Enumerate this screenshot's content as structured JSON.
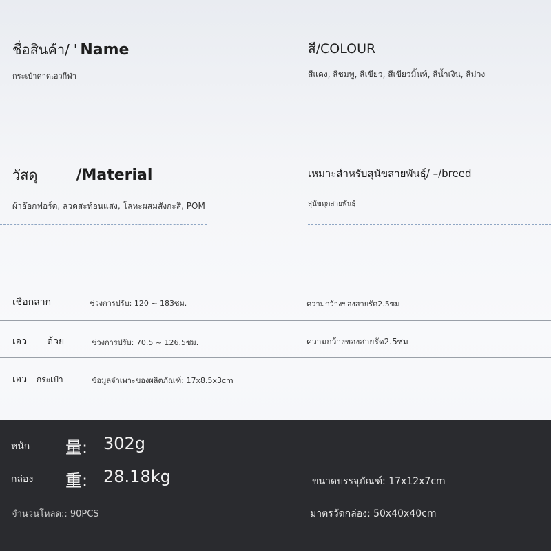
{
  "name_block": {
    "title_th": "ชื่อสินค้า/",
    "title_sep": "'",
    "title_en": "Name",
    "value": "กระเป๋าคาดเอวกีฬา"
  },
  "colour_block": {
    "title": "สี/COLOUR",
    "value": "สีแดง, สีชมพู, สีเขียว, สีเขียวมิ้นท์, สีน้ำเงิน, สีม่วง"
  },
  "material_block": {
    "title_th": "วัสดุ",
    "title_en": "/Material",
    "value": "ผ้าอ๊อกฟอร์ด, ลวดสะท้อนแสง, โลหะผสมสังกะสี, POM"
  },
  "breed_block": {
    "title": "เหมาะสำหรับสุนัขสายพันธุ์/ –/breed",
    "value": "สุนัขทุกสายพันธุ์"
  },
  "rows": [
    {
      "label_a": "เชือกลาก",
      "label_b": "",
      "value": "ช่วงการปรับ: 120 ~ 183ซม.",
      "extra": "ความกว้างของสายรัด2.5ซม"
    },
    {
      "label_a": "เอว",
      "label_b": "ด้วย",
      "value": "ช่วงการปรับ: 70.5 ~ 126.5ซม.",
      "extra": "ความกว้างของสายรัด2.5ซม"
    },
    {
      "label_a": "เอว",
      "label_b": "กระเป๋า",
      "value": "ข้อมูลจำเพาะของผลิตภัณฑ์: 17x8.5x3cm",
      "extra": ""
    }
  ],
  "footer": {
    "weight_label": "หนัก",
    "weight_char": "量:",
    "weight_value": "302g",
    "box_label": "กล่อง",
    "box_char": "重:",
    "box_value": "28.18kg",
    "package_size": "ขนาดบรรจุภัณฑ์: 17x12x7cm",
    "load_qty": "จำนวนโหลด:: 90PCS",
    "carton_size": "มาตรวัดกล่อง: 50x40x40cm"
  },
  "colors": {
    "footer_bg": "#2a2b2f",
    "dash": "#8fa6c4"
  }
}
